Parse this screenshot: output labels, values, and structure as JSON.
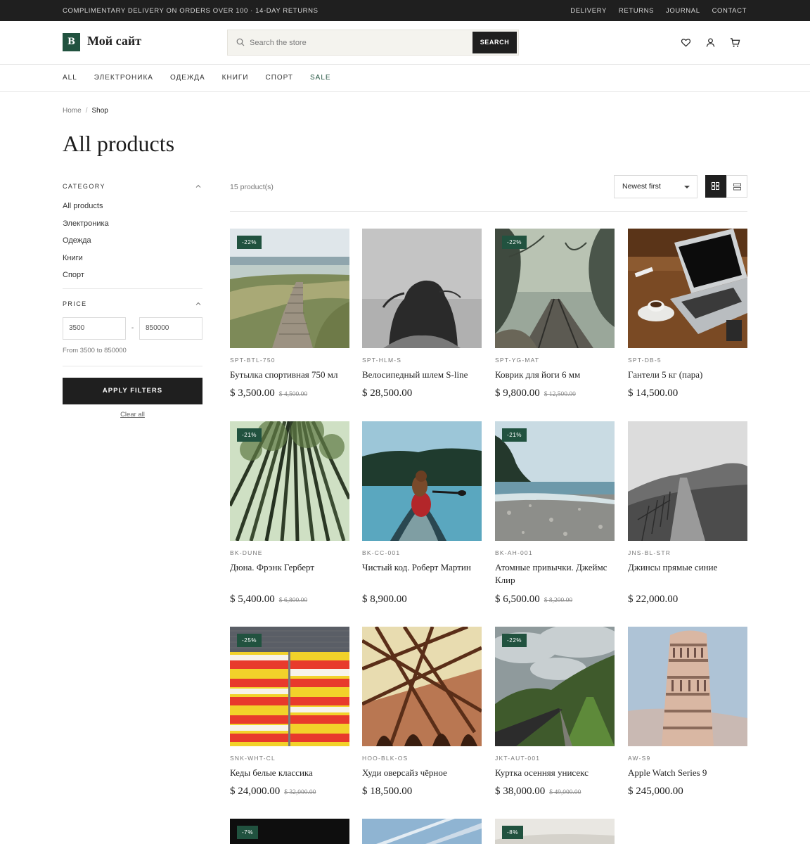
{
  "topbar": {
    "promo": "COMPLIMENTARY DELIVERY ON ORDERS OVER 100 · 14-DAY RETURNS",
    "links": [
      "DELIVERY",
      "RETURNS",
      "JOURNAL",
      "CONTACT"
    ]
  },
  "header": {
    "logo_letter": "B",
    "site_name": "Мой сайт",
    "search_placeholder": "Search the store",
    "search_button": "SEARCH",
    "icons": [
      "heart-icon",
      "user-icon",
      "cart-icon"
    ]
  },
  "nav": {
    "items": [
      "ALL",
      "ЭЛЕКТРОНИКА",
      "ОДЕЖДА",
      "КНИГИ",
      "СПОРТ",
      "SALE"
    ]
  },
  "breadcrumb": {
    "home": "Home",
    "separator": "/",
    "current": "Shop"
  },
  "page_title": "All products",
  "filters": {
    "category_title": "CATEGORY",
    "categories": [
      "All products",
      "Электроника",
      "Одежда",
      "Книги",
      "Спорт"
    ],
    "price_title": "PRICE",
    "price_min": "3500",
    "price_max": "850000",
    "price_sep": "-",
    "price_hint": "From 3500 to 850000",
    "apply_label": "APPLY FILTERS",
    "clear_label": "Clear all"
  },
  "toolbar": {
    "count": "15 product(s)",
    "sort_value": "Newest first"
  },
  "colors": {
    "accent": "#21523f",
    "dark": "#1f1f1f"
  },
  "products": [
    {
      "badge": "-22%",
      "sku": "SPT-BTL-750",
      "name": "Бутылка спортивная 750 мл",
      "price": "$ 3,500.00",
      "old_price": "$ 4,500.00"
    },
    {
      "badge": "",
      "sku": "SPT-HLM-S",
      "name": "Велосипедный шлем S-line",
      "price": "$ 28,500.00",
      "old_price": ""
    },
    {
      "badge": "-22%",
      "sku": "SPT-YG-MAT",
      "name": "Коврик для йоги 6 мм",
      "price": "$ 9,800.00",
      "old_price": "$ 12,500.00"
    },
    {
      "badge": "",
      "sku": "SPT-DB-5",
      "name": "Гантели 5 кг (пара)",
      "price": "$ 14,500.00",
      "old_price": ""
    },
    {
      "badge": "-21%",
      "sku": "BK-DUNE",
      "name": "Дюна. Фрэнк Герберт",
      "price": "$ 5,400.00",
      "old_price": "$ 6,800.00"
    },
    {
      "badge": "",
      "sku": "BK-CC-001",
      "name": "Чистый код. Роберт Мартин",
      "price": "$ 8,900.00",
      "old_price": ""
    },
    {
      "badge": "-21%",
      "sku": "BK-AH-001",
      "name": "Атомные привычки. Джеймс Клир",
      "price": "$ 6,500.00",
      "old_price": "$ 8,200.00"
    },
    {
      "badge": "",
      "sku": "JNS-BL-STR",
      "name": "Джинсы прямые синие",
      "price": "$ 22,000.00",
      "old_price": ""
    },
    {
      "badge": "-25%",
      "sku": "SNK-WHT-CL",
      "name": "Кеды белые классика",
      "price": "$ 24,000.00",
      "old_price": "$ 32,000.00"
    },
    {
      "badge": "",
      "sku": "HOO-BLK-OS",
      "name": "Худи оверсайз чёрное",
      "price": "$ 18,500.00",
      "old_price": ""
    },
    {
      "badge": "-22%",
      "sku": "JKT-AUT-001",
      "name": "Куртка осенняя унисекс",
      "price": "$ 38,000.00",
      "old_price": "$ 49,000.00"
    },
    {
      "badge": "",
      "sku": "AW-S9",
      "name": "Apple Watch Series 9",
      "price": "$ 245,000.00",
      "old_price": ""
    },
    {
      "badge": "-7%",
      "sku": "",
      "name": "",
      "price": "",
      "old_price": ""
    },
    {
      "badge": "",
      "sku": "",
      "name": "",
      "price": "",
      "old_price": ""
    },
    {
      "badge": "-8%",
      "sku": "",
      "name": "",
      "price": "",
      "old_price": ""
    }
  ]
}
